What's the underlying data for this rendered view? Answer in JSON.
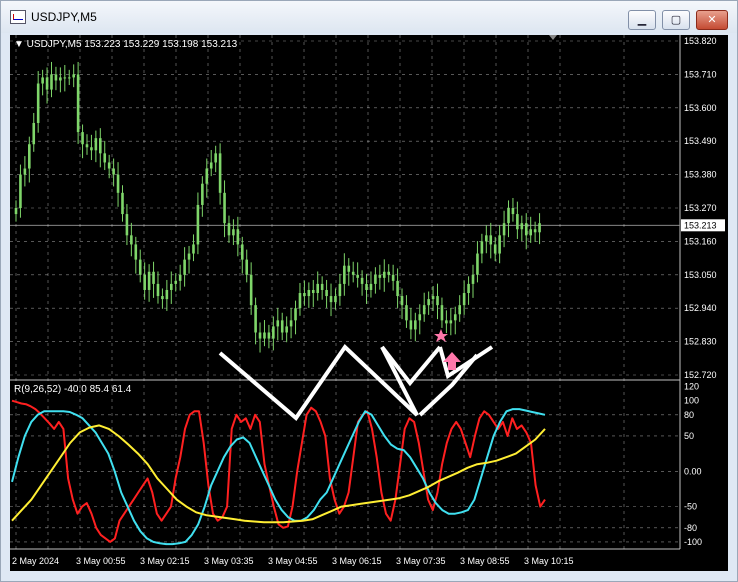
{
  "window": {
    "title": "USDJPY,M5",
    "minimize_glyph": "▁",
    "maximize_glyph": "▢",
    "close_glyph": "✕"
  },
  "main_header": {
    "marker": "▼",
    "text": "USDJPY,M5  153.223 153.229 153.198 153.213"
  },
  "indicator_header": "R(9,26,52) -40.0 85.4 61.4",
  "price_axis": [
    "153.820",
    "153.710",
    "153.600",
    "153.490",
    "153.380",
    "153.270",
    "153.160",
    "153.050",
    "152.940",
    "152.830",
    "152.720"
  ],
  "current_price": "153.213",
  "indicator_axis": [
    {
      "label": "120",
      "v": 120
    },
    {
      "label": "100",
      "v": 100
    },
    {
      "label": "80",
      "v": 80
    },
    {
      "label": "50",
      "v": 50
    },
    {
      "label": "0.00",
      "v": 0
    },
    {
      "label": "-50",
      "v": -50
    },
    {
      "label": "-80",
      "v": -80
    },
    {
      "label": "-100",
      "v": -100
    }
  ],
  "time_axis": [
    "2 May 2024",
    "3 May 00:55",
    "3 May 02:15",
    "3 May 03:35",
    "3 May 04:55",
    "3 May 06:15",
    "3 May 07:35",
    "3 May 08:55",
    "3 May 10:15"
  ],
  "colors": {
    "bg": "#000000",
    "grid": "#ffffff",
    "candles": "#7fd66a",
    "red": "#ff2020",
    "cyan": "#40e0f0",
    "yellow": "#ffee33",
    "drawing": "#ffffff",
    "signal": "#ff77aa"
  },
  "chart_data": {
    "type": "line",
    "price_range": [
      152.72,
      153.82
    ],
    "close_series": [
      153.27,
      153.38,
      153.4,
      153.48,
      153.55,
      153.68,
      153.7,
      153.66,
      153.71,
      153.69,
      153.7,
      153.7,
      153.7,
      153.71,
      153.52,
      153.48,
      153.47,
      153.46,
      153.5,
      153.45,
      153.42,
      153.4,
      153.38,
      153.32,
      153.25,
      153.18,
      153.15,
      153.1,
      153.05,
      153.0,
      153.06,
      153.02,
      152.98,
      152.97,
      153.0,
      153.02,
      153.03,
      153.05,
      153.1,
      153.12,
      153.15,
      153.28,
      153.35,
      153.4,
      153.42,
      153.45,
      153.32,
      153.22,
      153.18,
      153.2,
      153.15,
      153.1,
      153.05,
      152.95,
      152.86,
      152.84,
      152.86,
      152.84,
      152.88,
      152.9,
      152.86,
      152.88,
      152.9,
      152.94,
      152.99,
      152.98,
      153.0,
      152.99,
      153.02,
      153.0,
      152.98,
      152.96,
      152.98,
      153.02,
      153.08,
      153.06,
      153.05,
      153.04,
      153.02,
      153.0,
      153.02,
      153.05,
      153.04,
      153.06,
      153.05,
      153.03,
      152.98,
      152.95,
      152.9,
      152.87,
      152.9,
      152.92,
      152.95,
      152.97,
      152.98,
      152.95,
      152.9,
      152.89,
      152.9,
      152.92,
      152.95,
      152.99,
      153.02,
      153.05,
      153.12,
      153.16,
      153.18,
      153.15,
      153.12,
      153.18,
      153.22,
      153.27,
      153.25,
      153.2,
      153.22,
      153.18,
      153.2,
      153.19,
      153.22
    ],
    "indicator_range": [
      -110,
      125
    ],
    "series": [
      {
        "color": "red",
        "values": [
          100,
          98,
          96,
          95,
          92,
          88,
          82,
          75,
          68,
          60,
          70,
          60,
          -10,
          -40,
          -60,
          -50,
          -45,
          -60,
          -80,
          -90,
          -95,
          -100,
          -95,
          -70,
          -60,
          -50,
          -40,
          -30,
          -20,
          -10,
          -30,
          -60,
          -70,
          -60,
          -50,
          -10,
          20,
          60,
          80,
          85,
          85,
          40,
          -20,
          -60,
          -70,
          -65,
          -50,
          60,
          80,
          70,
          75,
          60,
          80,
          70,
          10,
          -20,
          -50,
          -75,
          -80,
          -78,
          -50,
          0,
          40,
          80,
          90,
          85,
          70,
          50,
          -10,
          -40,
          -60,
          -50,
          -30,
          20,
          70,
          80,
          85,
          60,
          20,
          -30,
          -60,
          -70,
          -40,
          10,
          60,
          75,
          70,
          40,
          0,
          -40,
          -55,
          -30,
          10,
          40,
          60,
          70,
          60,
          40,
          20,
          50,
          75,
          85,
          80,
          70,
          60,
          70,
          50,
          75,
          60,
          65,
          55,
          40,
          -20,
          -50,
          -40
        ]
      },
      {
        "color": "cyan",
        "values": [
          -15,
          20,
          50,
          70,
          80,
          85,
          85,
          85,
          85,
          84,
          80,
          75,
          65,
          55,
          40,
          25,
          0,
          -30,
          -50,
          -70,
          -85,
          -95,
          -100,
          -102,
          -103,
          -103,
          -102,
          -100,
          -90,
          -75,
          -50,
          -20,
          0,
          20,
          35,
          45,
          48,
          40,
          20,
          0,
          -20,
          -40,
          -55,
          -65,
          -70,
          -70,
          -65,
          -55,
          -40,
          -30,
          -10,
          10,
          30,
          50,
          70,
          85,
          80,
          65,
          50,
          38,
          32,
          30,
          20,
          5,
          -10,
          -30,
          -45,
          -55,
          -60,
          -60,
          -58,
          -55,
          -40,
          -10,
          20,
          50,
          70,
          85,
          88,
          88,
          86,
          84,
          82,
          80
        ]
      },
      {
        "color": "yellow",
        "values": [
          -70,
          -55,
          -40,
          -20,
          0,
          20,
          40,
          55,
          62,
          65,
          60,
          50,
          38,
          25,
          10,
          -10,
          -25,
          -40,
          -50,
          -58,
          -62,
          -64,
          -66,
          -68,
          -70,
          -71,
          -72,
          -72,
          -72,
          -71,
          -70,
          -68,
          -62,
          -56,
          -50,
          -48,
          -46,
          -44,
          -42,
          -40,
          -38,
          -34,
          -28,
          -22,
          -14,
          -8,
          -2,
          5,
          10,
          12,
          15,
          20,
          25,
          35,
          45,
          60
        ]
      }
    ]
  }
}
